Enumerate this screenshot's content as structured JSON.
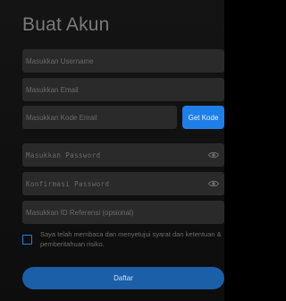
{
  "page": {
    "title": "Buat Akun"
  },
  "form": {
    "username": {
      "placeholder": "Masukkan Username",
      "value": ""
    },
    "email": {
      "placeholder": "Masukkan Email",
      "value": ""
    },
    "email_code": {
      "placeholder": "Masukkan Kode Email",
      "value": ""
    },
    "get_code_label": "Get Kode",
    "password": {
      "placeholder": "Masukkan Password",
      "value": ""
    },
    "confirm_password": {
      "placeholder": "Konfirmasi Password",
      "value": ""
    },
    "referral": {
      "placeholder": "Masukkan ID Referensi (opsional)",
      "value": ""
    },
    "agreement_text": "Saya telah membaca dan menyetujui syarat dan ketentuan & pemberitahuan risiko.",
    "agreement_checked": false,
    "submit_label": "Daftar"
  },
  "icons": {
    "password_toggle": "eye-icon",
    "confirm_toggle": "eye-icon"
  },
  "colors": {
    "background": "#0f0f0f",
    "field": "#2a2a2a",
    "accent": "#1f7fe8",
    "submit": "#1a5fa8"
  }
}
